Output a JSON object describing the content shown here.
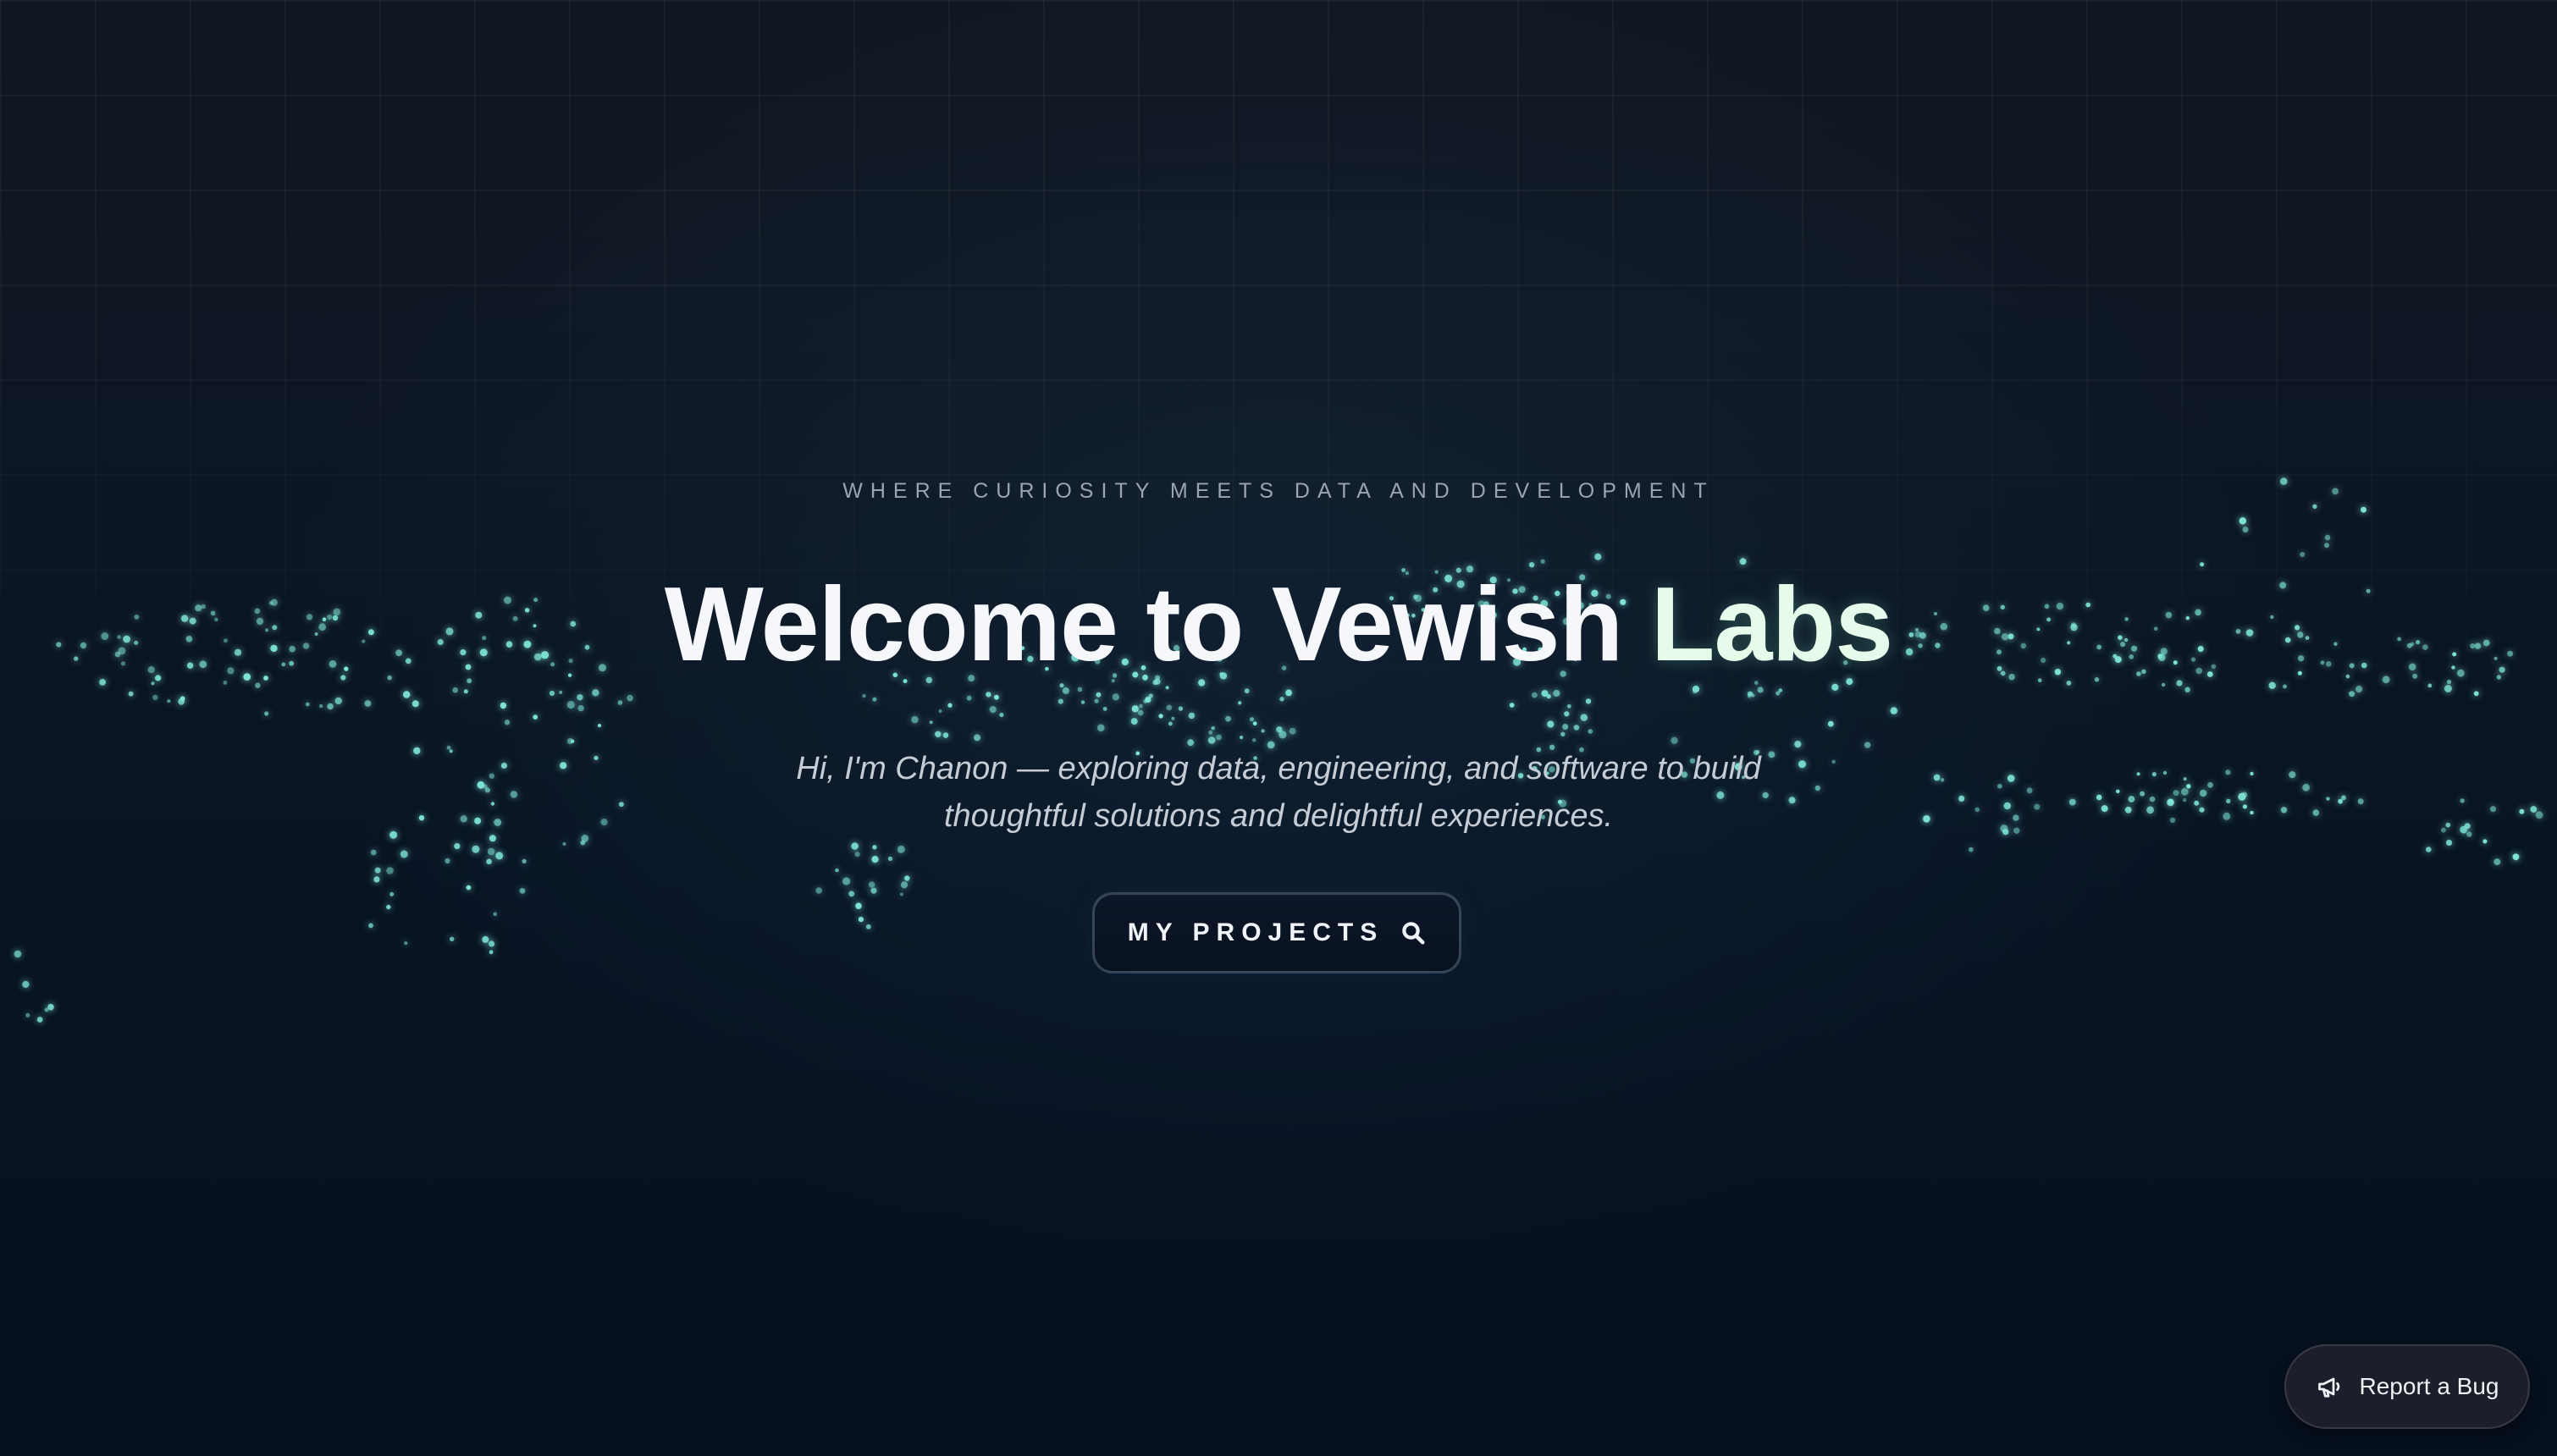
{
  "hero": {
    "tagline": "WHERE CURIOSITY MEETS DATA AND DEVELOPMENT",
    "headline_main": "Welcome to Vewish ",
    "headline_accent": "Labs",
    "intro_line1": "Hi, I'm Chanon — exploring data, engineering, and software to build",
    "intro_line2": "thoughtful solutions and delightful experiences.",
    "cta_label": "MY PROJECTS",
    "cta_icon": "search-icon"
  },
  "floating": {
    "report_bug_label": "Report a Bug",
    "report_bug_icon": "megaphone-icon"
  },
  "colors": {
    "background": "#07111f",
    "particle": "#7fe6d8",
    "accent_text": "#e6fbea",
    "headline": "#f5f7fa"
  }
}
